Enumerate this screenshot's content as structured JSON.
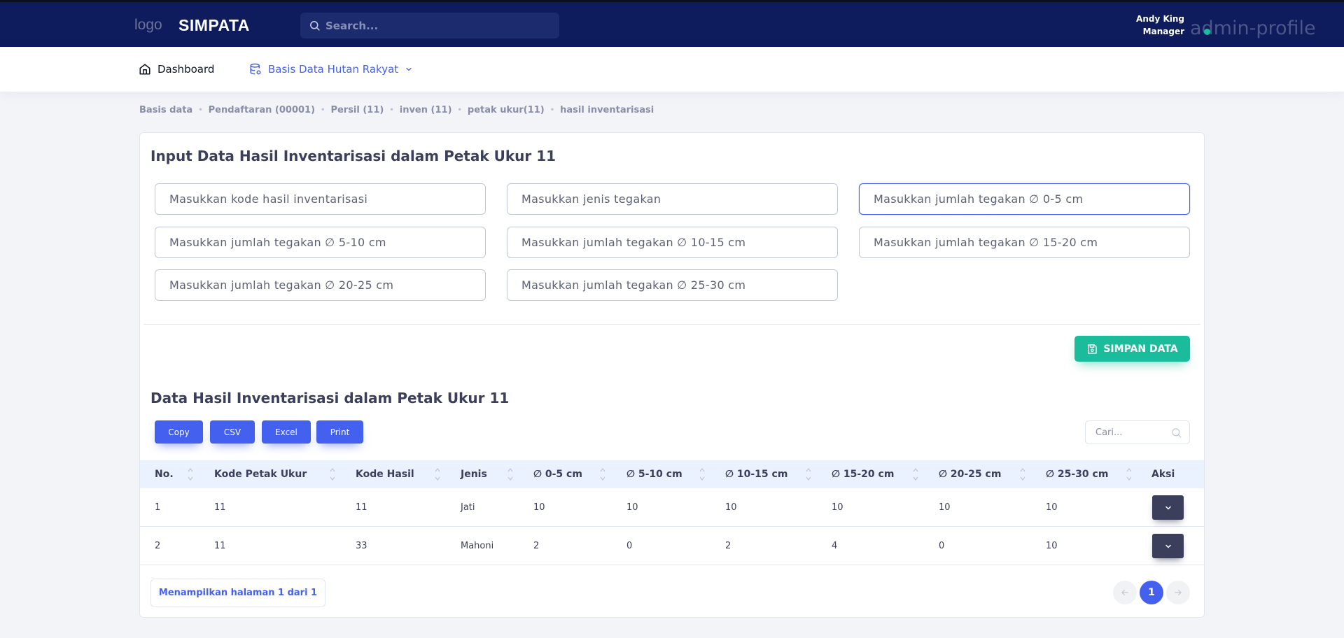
{
  "header": {
    "logo_text": "logo",
    "brand": "SIMPATA",
    "search_placeholder": "Search...",
    "user_name": "Andy King",
    "user_role": "Manager",
    "avatar_alt": "admin-profile"
  },
  "nav": {
    "dashboard": "Dashboard",
    "basis_data": "Basis Data Hutan Rakyat"
  },
  "breadcrumb": [
    "Basis data",
    "Pendaftaran (00001)",
    "Persil (11)",
    "inven (11)",
    "petak ukur(11)",
    "hasil inventarisasi"
  ],
  "form": {
    "title": "Input Data Hasil Inventarisasi dalam Petak Ukur 11",
    "fields": [
      "Masukkan kode hasil inventarisasi",
      "Masukkan jenis tegakan",
      "Masukkan jumlah tegakan ∅ 0-5 cm",
      "Masukkan jumlah tegakan ∅ 5-10 cm",
      "Masukkan jumlah tegakan ∅ 10-15 cm",
      "Masukkan jumlah tegakan ∅ 15-20 cm",
      "Masukkan jumlah tegakan ∅ 20-25 cm",
      "Masukkan jumlah tegakan ∅ 25-30 cm"
    ],
    "save_label": "SIMPAN DATA"
  },
  "table_section": {
    "title": "Data Hasil Inventarisasi dalam Petak Ukur 11",
    "export_buttons": [
      "Copy",
      "CSV",
      "Excel",
      "Print"
    ],
    "search_placeholder": "Cari...",
    "columns": [
      "No.",
      "Kode Petak Ukur",
      "Kode Hasil",
      "Jenis",
      "∅ 0-5 cm",
      "∅ 5-10 cm",
      "∅ 10-15 cm",
      "∅ 15-20 cm",
      "∅ 20-25 cm",
      "∅ 25-30 cm",
      "Aksi"
    ],
    "rows": [
      [
        "1",
        "11",
        "11",
        "Jati",
        "10",
        "10",
        "10",
        "10",
        "10",
        "10"
      ],
      [
        "2",
        "11",
        "33",
        "Mahoni",
        "2",
        "0",
        "2",
        "4",
        "0",
        "10"
      ]
    ],
    "page_info": "Menampilkan halaman 1 dari 1",
    "current_page": "1"
  },
  "colors": {
    "header_bg": "#0e1b5c",
    "accent": "#4361ee",
    "success": "#1abc9c",
    "dark_button": "#3b3f5c"
  }
}
